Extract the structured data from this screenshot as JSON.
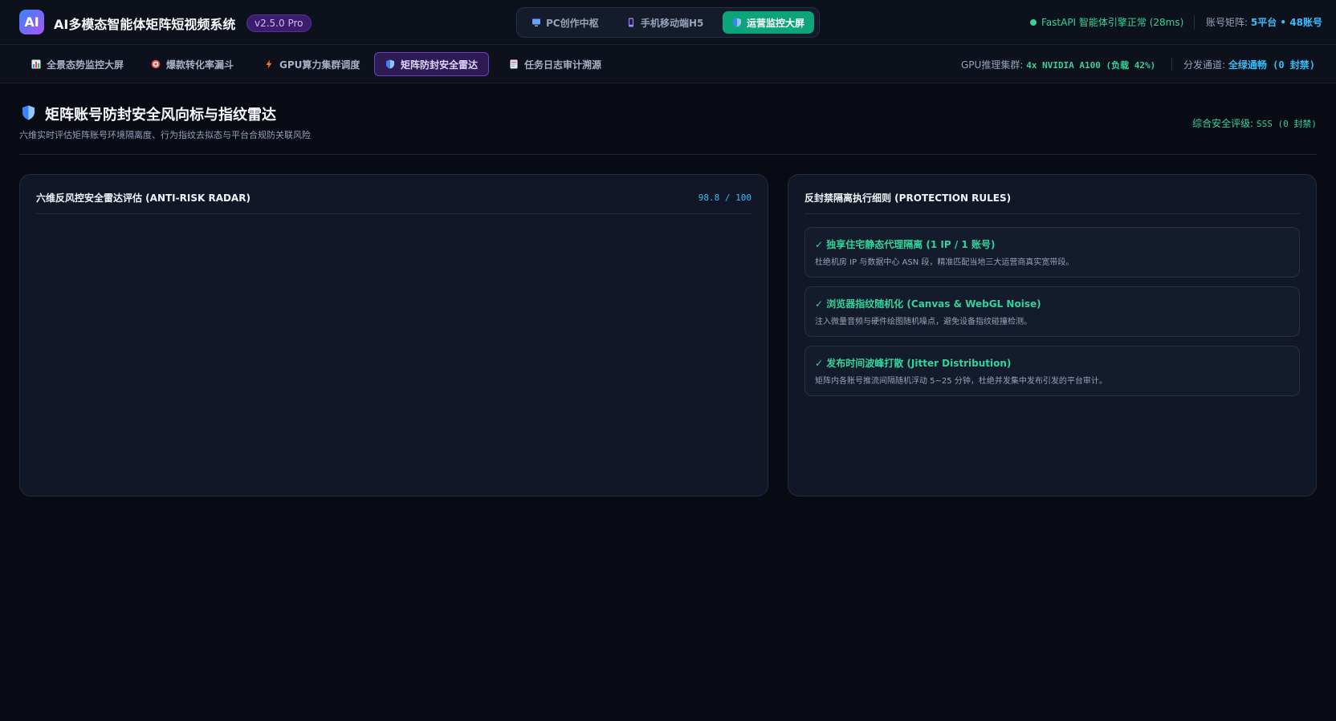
{
  "header": {
    "logo_text": "AI",
    "app_title": "AI多模态智能体矩阵短视频系统",
    "version": "v2.5.0 Pro",
    "modes": [
      {
        "label": "PC创作中枢",
        "icon": "monitor-icon"
      },
      {
        "label": "手机移动端H5",
        "icon": "phone-icon"
      },
      {
        "label": "运营监控大屏",
        "icon": "shield-icon",
        "active": true
      }
    ],
    "engine_status": "FastAPI 智能体引擎正常 (28ms)",
    "matrix_label": "账号矩阵:",
    "matrix_value": "5平台 • 48账号"
  },
  "nav": {
    "items": [
      {
        "label": "全景态势监控大屏",
        "icon": "bar-chart-icon"
      },
      {
        "label": "爆款转化率漏斗",
        "icon": "target-icon"
      },
      {
        "label": "GPU算力集群调度",
        "icon": "lightning-icon"
      },
      {
        "label": "矩阵防封安全雷达",
        "icon": "shield-icon",
        "active": true
      },
      {
        "label": "任务日志审计溯源",
        "icon": "document-icon"
      }
    ],
    "gpu_label": "GPU推理集群:",
    "gpu_value": "4x NVIDIA A100 (负载 42%)",
    "dispatch_label": "分发通道:",
    "dispatch_value": "全绿通畅 (0 封禁)"
  },
  "page": {
    "title": "矩阵账号防封安全风向标与指纹雷达",
    "subtitle": "六维实时评估矩阵账号环境隔离度、行为指纹去拟态与平台合规防关联风险",
    "safety_label": "综合安全评级:",
    "safety_value": "SSS (0 封禁)"
  },
  "radar_panel": {
    "title": "六维反风控安全雷达评估 (ANTI-RISK RADAR)",
    "score": "98.8 / 100"
  },
  "rules_panel": {
    "title": "反封禁隔离执行细则 (PROTECTION RULES)",
    "rules": [
      {
        "title": "✓ 独享住宅静态代理隔离 (1 IP / 1 账号)",
        "desc": "杜绝机房 IP 与数据中心 ASN 段，精准匹配当地三大运营商真实宽带段。"
      },
      {
        "title": "✓ 浏览器指纹随机化 (Canvas & WebGL Noise)",
        "desc": "注入微量音频与硬件绘图随机噪点，避免设备指纹碰撞检测。"
      },
      {
        "title": "✓ 发布时间波峰打散 (Jitter Distribution)",
        "desc": "矩阵内各账号推流间隔随机浮动 5~25 分钟，杜绝并发集中发布引发的平台审计。"
      }
    ]
  },
  "colors": {
    "background": "#080b14",
    "accent_green": "#34d399",
    "accent_blue": "#38bdf8",
    "accent_purple": "#6d3fc4",
    "active_mode": "#0ea47a"
  }
}
